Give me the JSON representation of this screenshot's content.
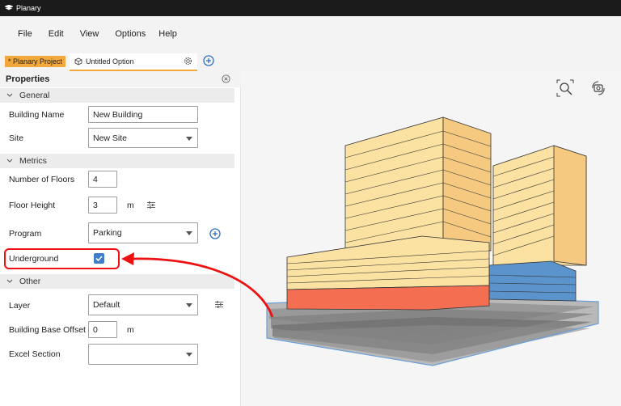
{
  "window": {
    "title": "Planary"
  },
  "menu": {
    "items": [
      "File",
      "Edit",
      "View",
      "Options",
      "Help"
    ]
  },
  "tabs": {
    "project_label": "* Planary Project",
    "option_label": "Untitled Option"
  },
  "panel": {
    "title": "Properties",
    "sections": {
      "general": "General",
      "metrics": "Metrics",
      "other": "Other"
    },
    "building_name": {
      "label": "Building Name",
      "value": "New Building"
    },
    "site": {
      "label": "Site",
      "value": "New Site"
    },
    "number_of_floors": {
      "label": "Number of Floors",
      "value": "4"
    },
    "floor_height": {
      "label": "Floor Height",
      "value": "3",
      "unit": "m"
    },
    "program": {
      "label": "Program",
      "value": "Parking"
    },
    "underground": {
      "label": "Underground",
      "checked": true
    },
    "layer": {
      "label": "Layer",
      "value": "Default"
    },
    "building_base_offset": {
      "label": "Building Base Offset",
      "value": "0",
      "unit": "m"
    },
    "excel_section": {
      "label": "Excel Section",
      "value": ""
    }
  },
  "colors": {
    "accent": "#f3a83b",
    "checkbox": "#3f7ec7",
    "annotation": "#e11111",
    "tower_yellow": "#fce2a2",
    "podium_red": "#f46f52",
    "blue_floors": "#5b93cc",
    "underground_gray": "#8f8f8f"
  }
}
